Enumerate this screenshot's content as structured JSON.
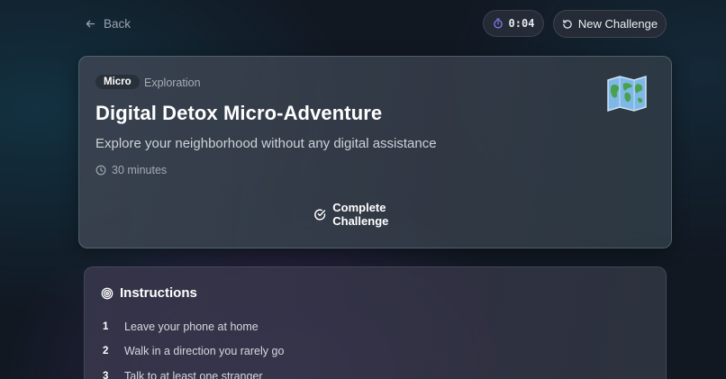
{
  "nav": {
    "back_label": "Back"
  },
  "timer": {
    "value": "0:04"
  },
  "header": {
    "new_challenge_label": "New Challenge"
  },
  "challenge": {
    "badge": "Micro",
    "category": "Exploration",
    "title": "Digital Detox Micro-Adventure",
    "description": "Explore your neighborhood without any digital assistance",
    "duration": "30 minutes",
    "icon": "world-map-icon",
    "complete_label": "Complete Challenge"
  },
  "instructions": {
    "title": "Instructions",
    "steps": [
      {
        "num": "1",
        "text": "Leave your phone at home"
      },
      {
        "num": "2",
        "text": "Walk in a direction you rarely go"
      },
      {
        "num": "3",
        "text": "Talk to at least one stranger"
      }
    ]
  },
  "colors": {
    "accent": "#8b7cf6",
    "card_border": "#5f8d96",
    "background": "#111822"
  }
}
